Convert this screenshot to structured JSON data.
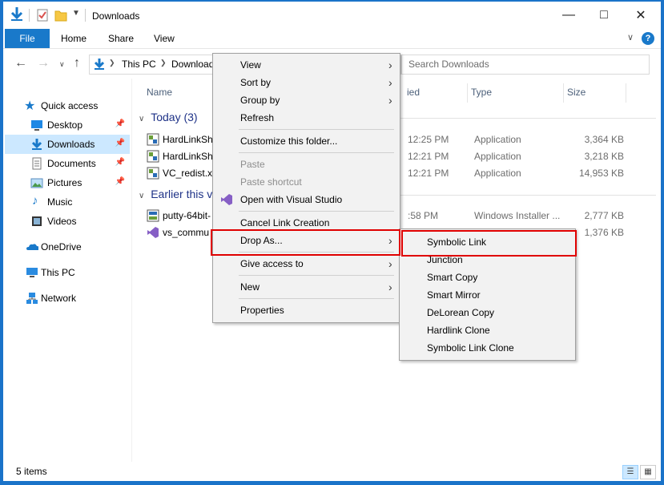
{
  "window": {
    "title": "Downloads",
    "ribbon_tabs": [
      "File",
      "Home",
      "Share",
      "View"
    ],
    "help": "?"
  },
  "address": {
    "crumbs": [
      "This PC",
      "Downloads"
    ],
    "search_placeholder": "Search Downloads"
  },
  "sidebar": {
    "quick_access": "Quick access",
    "items": [
      {
        "label": "Desktop",
        "icon": "desktop-icon",
        "pinned": true
      },
      {
        "label": "Downloads",
        "icon": "downloads-icon",
        "pinned": true,
        "selected": true
      },
      {
        "label": "Documents",
        "icon": "documents-icon",
        "pinned": true
      },
      {
        "label": "Pictures",
        "icon": "pictures-icon",
        "pinned": true
      },
      {
        "label": "Music",
        "icon": "music-icon",
        "pinned": false
      },
      {
        "label": "Videos",
        "icon": "videos-icon",
        "pinned": false
      }
    ],
    "roots": [
      "OneDrive",
      "This PC",
      "Network"
    ]
  },
  "columns": {
    "name": "Name",
    "date": "ied",
    "type": "Type",
    "size": "Size"
  },
  "groups": [
    {
      "label": "Today (3)",
      "rows": [
        {
          "name": "HardLinkSh",
          "date": "12:25 PM",
          "type": "Application",
          "size": "3,364 KB"
        },
        {
          "name": "HardLinkSh",
          "date": "12:21 PM",
          "type": "Application",
          "size": "3,218 KB"
        },
        {
          "name": "VC_redist.x",
          "date": "12:21 PM",
          "type": "Application",
          "size": "14,953 KB"
        }
      ]
    },
    {
      "label": "Earlier this v",
      "rows": [
        {
          "name": "putty-64bit-",
          "date": ":58 PM",
          "type": "Windows Installer ...",
          "size": "2,777 KB"
        },
        {
          "name": "vs_commu",
          "date": "",
          "type": "",
          "size": "1,376 KB"
        }
      ]
    }
  ],
  "status": {
    "items": "5 items"
  },
  "context_menu": {
    "items": [
      {
        "label": "View",
        "submenu": true
      },
      {
        "label": "Sort by",
        "submenu": true
      },
      {
        "label": "Group by",
        "submenu": true
      },
      {
        "label": "Refresh"
      },
      {
        "label": "Customize this folder..."
      },
      {
        "label": "Paste",
        "disabled": true
      },
      {
        "label": "Paste shortcut",
        "disabled": true
      },
      {
        "label": "Open with Visual Studio"
      },
      {
        "label": "Cancel Link Creation"
      },
      {
        "label": "Drop As...",
        "submenu": true,
        "highlighted": true
      },
      {
        "label": "Give access to",
        "submenu": true
      },
      {
        "label": "New",
        "submenu": true
      },
      {
        "label": "Properties"
      }
    ]
  },
  "drop_as_submenu": {
    "items": [
      "Symbolic Link",
      "Junction",
      "Smart Copy",
      "Smart Mirror",
      "DeLorean Copy",
      "Hardlink Clone",
      "Symbolic Link Clone"
    ],
    "highlighted": "Symbolic Link"
  },
  "colors": {
    "accent": "#1979ca",
    "highlight_box": "#e00000",
    "selection": "#cce8ff"
  }
}
